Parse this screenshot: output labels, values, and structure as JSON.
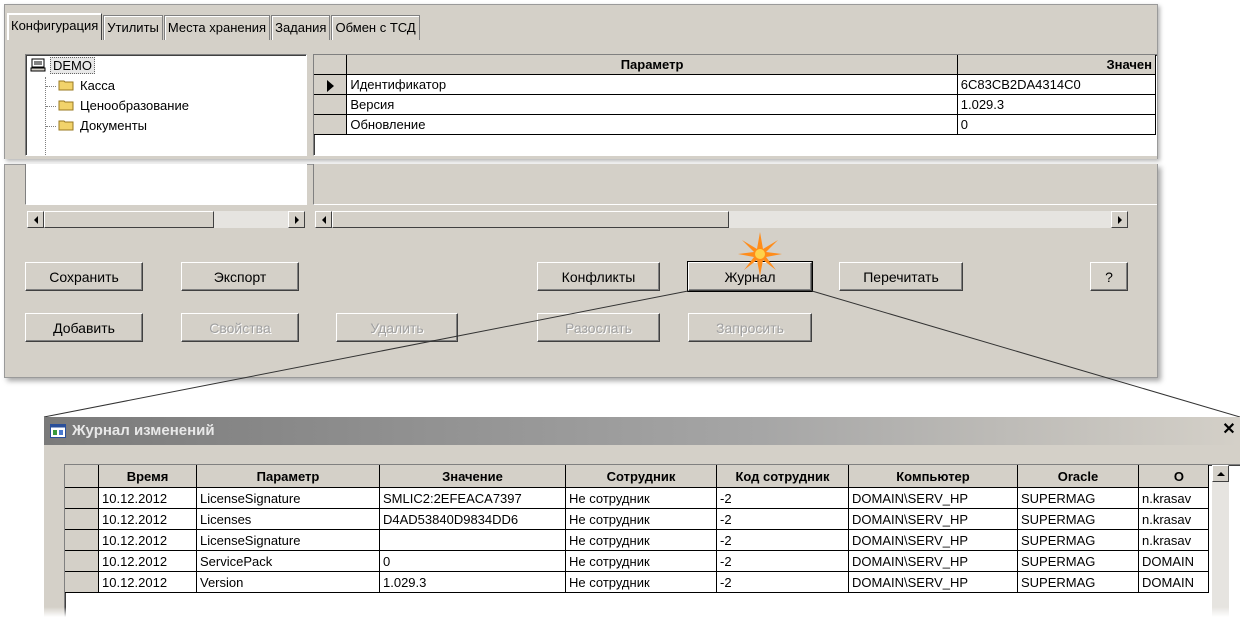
{
  "tabs": [
    "Конфигурация",
    "Утилиты",
    "Места хранения",
    "Задания",
    "Обмен с ТСД"
  ],
  "tree": {
    "root": "DEMO",
    "children": [
      "Касса",
      "Ценообразование",
      "Документы"
    ]
  },
  "config_grid": {
    "headers": [
      "Параметр",
      "Значен"
    ],
    "rows": [
      {
        "param": "Идентификатор",
        "value": "6C83CB2DA4314C0"
      },
      {
        "param": "Версия",
        "value": "1.029.3"
      },
      {
        "param": "Обновление",
        "value": "0"
      }
    ]
  },
  "buttons": {
    "save": "Сохранить",
    "export": "Экспорт",
    "conflicts": "Конфликты",
    "journal": "Журнал",
    "reread": "Перечитать",
    "help": "?",
    "add": "Добавить",
    "properties": "Свойства",
    "delete": "Удалить",
    "send": "Разослать",
    "request": "Запросить"
  },
  "journal": {
    "title": "Журнал изменений",
    "headers": [
      "Время",
      "Параметр",
      "Значение",
      "Сотрудник",
      "Код сотрудник",
      "Компьютер",
      "Oracle",
      "O"
    ],
    "rows": [
      [
        "10.12.2012",
        "LicenseSignature",
        "SMLIC2:2EFEACA7397",
        "Не сотрудник",
        "-2",
        "DOMAIN\\SERV_HP",
        "SUPERMAG",
        "n.krasav"
      ],
      [
        "10.12.2012",
        "Licenses",
        "D4AD53840D9834DD6",
        "Не сотрудник",
        "-2",
        "DOMAIN\\SERV_HP",
        "SUPERMAG",
        "n.krasav"
      ],
      [
        "10.12.2012",
        "LicenseSignature",
        "",
        "Не сотрудник",
        "-2",
        "DOMAIN\\SERV_HP",
        "SUPERMAG",
        "n.krasav"
      ],
      [
        "10.12.2012",
        "ServicePack",
        "0",
        "Не сотрудник",
        "-2",
        "DOMAIN\\SERV_HP",
        "SUPERMAG",
        "DOMAIN"
      ],
      [
        "10.12.2012",
        "Version",
        "1.029.3",
        "Не сотрудник",
        "-2",
        "DOMAIN\\SERV_HP",
        "SUPERMAG",
        "DOMAIN"
      ]
    ]
  },
  "colors": {
    "face": "#d4d0c8",
    "highlight_star": "#ff8c1a"
  }
}
